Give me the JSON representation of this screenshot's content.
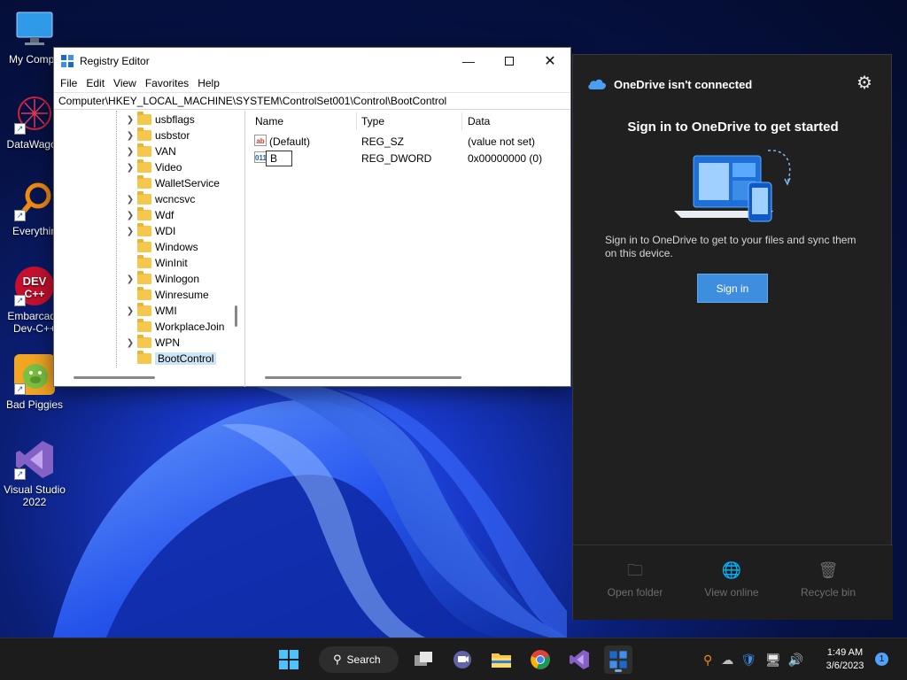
{
  "desktop": {
    "icons": [
      {
        "label": "My Compu",
        "icon": "monitor-icon"
      },
      {
        "label": "DataWagon",
        "icon": "datawagon-icon"
      },
      {
        "label": "Everythin",
        "icon": "everything-search-icon"
      },
      {
        "label": "Embarcade Dev-C++",
        "icon": "devcpp-icon"
      },
      {
        "label": "Bad Piggies",
        "icon": "bad-piggies-icon"
      },
      {
        "label": "Visual Studio 2022",
        "icon": "visual-studio-icon"
      }
    ]
  },
  "regedit": {
    "title": "Registry Editor",
    "menu": [
      "File",
      "Edit",
      "View",
      "Favorites",
      "Help"
    ],
    "address": "Computer\\HKEY_LOCAL_MACHINE\\SYSTEM\\ControlSet001\\Control\\BootControl",
    "tree": [
      {
        "label": "usbflags",
        "expandable": true
      },
      {
        "label": "usbstor",
        "expandable": true
      },
      {
        "label": "VAN",
        "expandable": true
      },
      {
        "label": "Video",
        "expandable": true
      },
      {
        "label": "WalletService",
        "expandable": false
      },
      {
        "label": "wcncsvc",
        "expandable": true
      },
      {
        "label": "Wdf",
        "expandable": true
      },
      {
        "label": "WDI",
        "expandable": true
      },
      {
        "label": "Windows",
        "expandable": false
      },
      {
        "label": "WinInit",
        "expandable": false
      },
      {
        "label": "Winlogon",
        "expandable": true
      },
      {
        "label": "Winresume",
        "expandable": false
      },
      {
        "label": "WMI",
        "expandable": true
      },
      {
        "label": "WorkplaceJoin",
        "expandable": false
      },
      {
        "label": "WPN",
        "expandable": true
      },
      {
        "label": "BootControl",
        "expandable": false,
        "selected": true
      }
    ],
    "columns": [
      "Name",
      "Type",
      "Data"
    ],
    "values": [
      {
        "icon": "ab",
        "name": "(Default)",
        "type": "REG_SZ",
        "data": "(value not set)"
      },
      {
        "icon": "011",
        "name": "B",
        "type": "REG_DWORD",
        "data": "0x00000000 (0)",
        "editing": true
      }
    ]
  },
  "onedrive": {
    "title": "OneDrive isn't connected",
    "heading": "Sign in to OneDrive to get started",
    "description": "Sign in to OneDrive to get to your files and sync them on this device.",
    "signin_label": "Sign in",
    "footer": [
      {
        "label": "Open folder",
        "icon": "folder-icon"
      },
      {
        "label": "View online",
        "icon": "globe-icon"
      },
      {
        "label": "Recycle bin",
        "icon": "recycle-bin-icon"
      }
    ]
  },
  "taskbar": {
    "search_label": "Search",
    "time": "1:49 AM",
    "date": "3/6/2023",
    "notification_count": "1"
  }
}
